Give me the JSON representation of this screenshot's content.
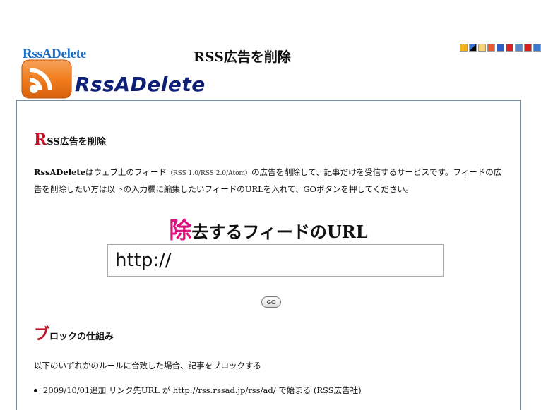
{
  "header": {
    "site_title_small": "RssADelete",
    "site_title_big": "RssADelete",
    "page_title": "RSS広告を削除",
    "logo_icon": "rss-feed-icon",
    "bookmark_icons": [
      "rss-icon",
      "delicious-icon",
      "hatena-icon",
      "buzzurl-icon",
      "bookmark-b-icon",
      "livedoor-icon",
      "pencil-icon",
      "flag-icon",
      "check-icon"
    ]
  },
  "section1": {
    "heading_initial": "R",
    "heading_rest": "SS広告を削除",
    "intro_name": "RssADelete",
    "intro_part1": "はウェブ上のフィード",
    "intro_small": "（RSS 1.0/RSS 2.0/Atom）",
    "intro_part2": "の広告を削除して、記事だけを受信するサービスです。フィードの広告を削除したい方は以下の入力欄に編集したいフィードのURLを入れて、GOボタンを押してください。"
  },
  "form": {
    "heading_initial": "除",
    "heading_rest": "去するフィードのURL",
    "url_value": "http://",
    "go_label": "GO"
  },
  "section2": {
    "heading_initial": "ブ",
    "heading_rest": "ロックの仕組み",
    "rule_text": "以下のいずれかのルールに合致した場合、記事をブロックする",
    "rules": [
      "2009/10/01追加 リンク先URL が http://rss.rssad.jp/rss/ad/ で始まる (RSS広告社)"
    ]
  },
  "colors": {
    "accent_red": "#c0162a",
    "accent_pink": "#e0117f",
    "frame_border": "#7e8ea1",
    "title_blue": "#1a6fc8",
    "title_navy": "#0e1f78"
  }
}
